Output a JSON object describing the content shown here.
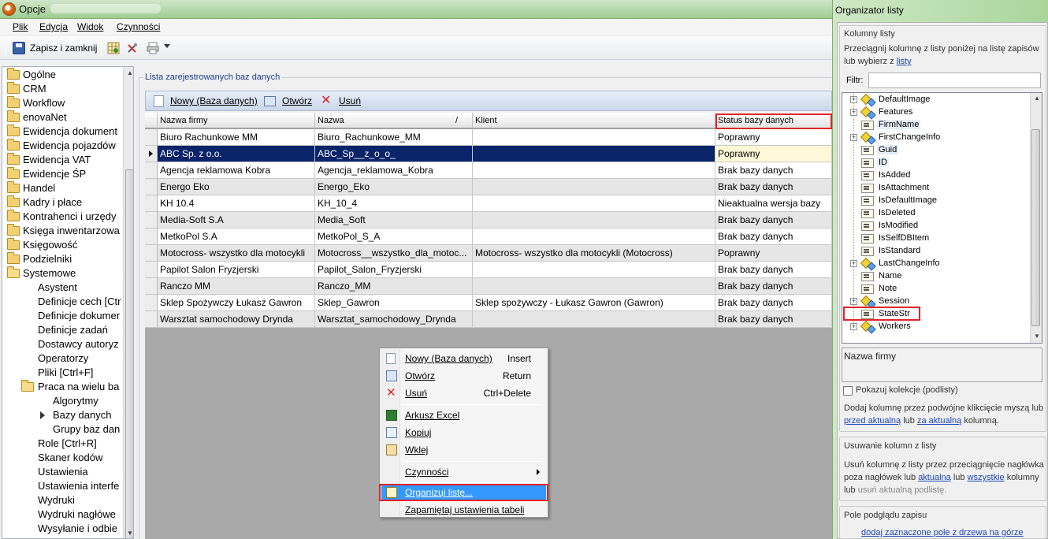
{
  "window": {
    "title": "Opcje"
  },
  "menubar": {
    "items": [
      "Plik",
      "Edycja",
      "Widok",
      "Czynności"
    ]
  },
  "toolbar": {
    "save_label": "Zapisz i zamknij"
  },
  "left_tree": {
    "items": [
      {
        "label": "Ogólne",
        "level": 0
      },
      {
        "label": "CRM",
        "level": 0
      },
      {
        "label": "Workflow",
        "level": 0
      },
      {
        "label": "enovaNet",
        "level": 0
      },
      {
        "label": "Ewidencja dokument",
        "level": 0
      },
      {
        "label": "Ewidencja pojazdów",
        "level": 0
      },
      {
        "label": "Ewidencja VAT",
        "level": 0
      },
      {
        "label": "Ewidencje ŚP",
        "level": 0
      },
      {
        "label": "Handel",
        "level": 0
      },
      {
        "label": "Kadry i płace",
        "level": 0
      },
      {
        "label": "Kontrahenci i urzędy",
        "level": 0
      },
      {
        "label": "Księga inwentarzowa",
        "level": 0
      },
      {
        "label": "Księgowość",
        "level": 0
      },
      {
        "label": "Podzielniki",
        "level": 0
      },
      {
        "label": "Systemowe",
        "level": 0
      },
      {
        "label": "Asystent",
        "level": 1
      },
      {
        "label": "Definicje cech [Ctr",
        "level": 1
      },
      {
        "label": "Definicje dokumer",
        "level": 1
      },
      {
        "label": "Definicje zadań",
        "level": 1
      },
      {
        "label": "Dostawcy autoryz",
        "level": 1
      },
      {
        "label": "Operatorzy",
        "level": 1
      },
      {
        "label": "Pliki [Ctrl+F]",
        "level": 1
      },
      {
        "label": "Praca na wielu ba",
        "level": 1
      },
      {
        "label": "Algorytmy",
        "level": 2
      },
      {
        "label": "Bazy danych",
        "level": 2
      },
      {
        "label": "Grupy baz dan",
        "level": 2
      },
      {
        "label": "Role [Ctrl+R]",
        "level": 1
      },
      {
        "label": "Skaner kodów",
        "level": 1
      },
      {
        "label": "Ustawienia",
        "level": 1
      },
      {
        "label": "Ustawienia interfe",
        "level": 1
      },
      {
        "label": "Wydruki",
        "level": 1
      },
      {
        "label": "Wydruki nagłówe",
        "level": 1
      },
      {
        "label": "Wysyłanie i odbie",
        "level": 1
      }
    ]
  },
  "group": {
    "title": "Lista zarejestrowanych baz danych"
  },
  "grid_toolbar": {
    "new_label": "Nowy (Baza danych)",
    "open_label": "Otwórz",
    "delete_label": "Usuń"
  },
  "grid": {
    "headers": [
      "Nazwa firmy",
      "Nazwa",
      "Klient",
      "Status bazy danych"
    ],
    "sort_indicator": "/",
    "rows": [
      [
        "Biuro Rachunkowe MM",
        "Biuro_Rachunkowe_MM",
        "",
        "Poprawny"
      ],
      [
        "ABC Sp. z o.o.",
        "ABC_Sp__z_o_o_",
        "",
        "Poprawny"
      ],
      [
        "Agencja reklamowa Kobra",
        "Agencja_reklamowa_Kobra",
        "",
        "Brak bazy danych"
      ],
      [
        "Energo Eko",
        "Energo_Eko",
        "",
        "Brak bazy danych"
      ],
      [
        "KH 10.4",
        "KH_10_4",
        "",
        "Nieaktualna wersja bazy"
      ],
      [
        "Media-Soft S.A",
        "Media_Soft",
        "",
        "Brak bazy danych"
      ],
      [
        "MetkoPol S.A",
        "MetkoPol_S_A",
        "",
        "Brak bazy danych"
      ],
      [
        "Motocross- wszystko dla motocykli",
        "Motocross__wszystko_dla_motoc...",
        "Motocross- wszystko dla motocykli (Motocross)",
        "Poprawny"
      ],
      [
        "Papilot Salon Fryzjerski",
        "Papilot_Salon_Fryzjerski",
        "",
        "Brak bazy danych"
      ],
      [
        "Ranczo MM",
        "Ranczo_MM",
        "",
        "Brak bazy danych"
      ],
      [
        "Sklep Spożywczy Łukasz Gawron",
        "Sklep_Gawron",
        "Sklep spożywczy - Łukasz Gawron (Gawron)",
        "Brak bazy danych"
      ],
      [
        "Warsztat samochodowy Drynda",
        "Warsztat_samochodowy_Drynda",
        "",
        "Brak bazy danych"
      ]
    ],
    "selected_row": 1
  },
  "context_menu": {
    "items": [
      {
        "label": "Nowy (Baza danych)",
        "shortcut": "Insert",
        "icon": "new-doc-icon"
      },
      {
        "label": "Otwórz",
        "shortcut": "Return",
        "icon": "open-icon"
      },
      {
        "label": "Usuń",
        "shortcut": "Ctrl+Delete",
        "icon": "delete-icon"
      },
      {
        "label": "Arkusz Excel",
        "shortcut": "",
        "icon": "excel-icon"
      },
      {
        "label": "Kopiuj",
        "shortcut": "",
        "icon": "copy-icon"
      },
      {
        "label": "Wklej",
        "shortcut": "",
        "icon": "paste-icon"
      },
      {
        "label": "Czynności",
        "shortcut": "",
        "icon": "submenu"
      },
      {
        "label": "Organizuj listę...",
        "shortcut": "",
        "icon": "organize-icon"
      },
      {
        "label": "Zapamiętaj ustawienia tabeli",
        "shortcut": "",
        "icon": ""
      }
    ]
  },
  "organizer": {
    "title": "Organizator listy",
    "columns_section": "Kolumny listy",
    "help_line1": "Przeciągnij kolumnę z listy poniżej na listę zapisów",
    "help_line2_prefix": "lub wybierz z",
    "help_line2_link": "listy",
    "filter_label": "Filtr:",
    "filter_value": "",
    "fields": [
      {
        "label": "DefaultImage",
        "type": "object",
        "expandable": true
      },
      {
        "label": "Features",
        "type": "object",
        "expandable": true
      },
      {
        "label": "FirmName",
        "type": "prop",
        "expandable": false
      },
      {
        "label": "FirstChangeInfo",
        "type": "object",
        "expandable": true
      },
      {
        "label": "Guid",
        "type": "prop",
        "expandable": false
      },
      {
        "label": "ID",
        "type": "prop",
        "expandable": false
      },
      {
        "label": "IsAdded",
        "type": "prop",
        "expandable": false
      },
      {
        "label": "IsAttachment",
        "type": "prop",
        "expandable": false
      },
      {
        "label": "IsDefaultImage",
        "type": "prop",
        "expandable": false
      },
      {
        "label": "IsDeleted",
        "type": "prop",
        "expandable": false
      },
      {
        "label": "IsModified",
        "type": "prop",
        "expandable": false
      },
      {
        "label": "IsSelfDBItem",
        "type": "prop",
        "expandable": false
      },
      {
        "label": "IsStandard",
        "type": "prop",
        "expandable": false
      },
      {
        "label": "LastChangeInfo",
        "type": "object",
        "expandable": true
      },
      {
        "label": "Name",
        "type": "prop",
        "expandable": false
      },
      {
        "label": "Note",
        "type": "prop",
        "expandable": false
      },
      {
        "label": "Session",
        "type": "object",
        "expandable": true
      },
      {
        "label": "StateStr",
        "type": "prop",
        "expandable": false
      },
      {
        "label": "Workers",
        "type": "object",
        "expandable": true
      }
    ],
    "preview_text": "Nazwa firmy",
    "show_collections_label": "Pokazuj kolekcje (podlisty)",
    "add_help_line1": "Dodaj kolumnę przez podwójne klikcięcie myszą lub",
    "add_link_before": "przed aktualną",
    "add_mid": "lub",
    "add_link_after": "za aktualną",
    "add_suffix": "kolumną.",
    "remove_section": "Usuwanie kolumn z listy",
    "remove_line1": "Usuń kolumnę z listy przez przeciągnięcie nagłówka",
    "remove_line2_prefix": "poza nagłówek lub",
    "remove_link_current": "aktualną",
    "remove_mid": "lub",
    "remove_link_all": "wszystkie",
    "remove_line2_suffix": "kolumny",
    "remove_line3_prefix": "lub",
    "remove_line3_rest": "usuń aktualną podlistę.",
    "preview_section": "Pole podglądu zapisu",
    "preview_link": "dodaj zaznaczone pole z drzewa na górze"
  },
  "colors": {
    "highlight_red": "#e0242a",
    "selection_blue": "#0a246a",
    "menu_highlight": "#3399ff",
    "link_blue": "#1c44b6"
  }
}
